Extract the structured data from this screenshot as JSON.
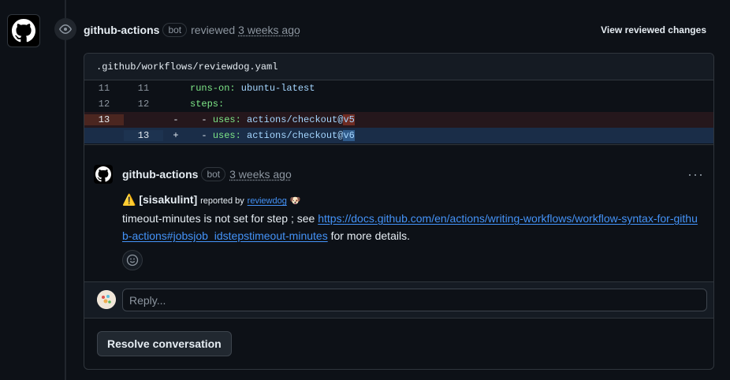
{
  "review": {
    "author": "github-actions",
    "badge": "bot",
    "action": "reviewed",
    "time": "3 weeks ago",
    "view_changes": "View reviewed changes"
  },
  "file": {
    "path": ".github/workflows/reviewdog.yaml"
  },
  "diff": [
    {
      "type": "context",
      "old": "11",
      "new": "11",
      "marker": "",
      "key": "runs-on:",
      "val": " ubuntu-latest",
      "indent": "",
      "prefix": "",
      "hl": ""
    },
    {
      "type": "context",
      "old": "12",
      "new": "12",
      "marker": "",
      "key": "steps:",
      "val": "",
      "indent": "",
      "prefix": "",
      "hl": ""
    },
    {
      "type": "del",
      "old": "13",
      "new": "",
      "marker": "-",
      "key": "uses:",
      "val": " actions/checkout@",
      "indent": "  - ",
      "prefix": "",
      "hl": "v5"
    },
    {
      "type": "add",
      "old": "",
      "new": "13",
      "marker": "+",
      "key": "uses:",
      "val": " actions/checkout@",
      "indent": "  - ",
      "prefix": "",
      "hl": "v6"
    }
  ],
  "comment": {
    "author": "github-actions",
    "badge": "bot",
    "time": "3 weeks ago",
    "menu": "···",
    "warn_icon": "⚠️",
    "tag": "[sisakulint]",
    "reported_by": "reported by",
    "reporter": "reviewdog",
    "reporter_emoji": "🐶",
    "text_before": "timeout-minutes is not set for step ; see ",
    "link": "https://docs.github.com/en/actions/writing-workflows/workflow-syntax-for-github-actions#jobsjob_idstepstimeout-minutes",
    "text_after": " for more details."
  },
  "reply": {
    "placeholder": "Reply..."
  },
  "resolve_label": "Resolve conversation",
  "colors": {
    "background": "#0d1117",
    "link": "#4493f8",
    "del_bg": "#25171c",
    "add_bg": "#1a2d48"
  }
}
